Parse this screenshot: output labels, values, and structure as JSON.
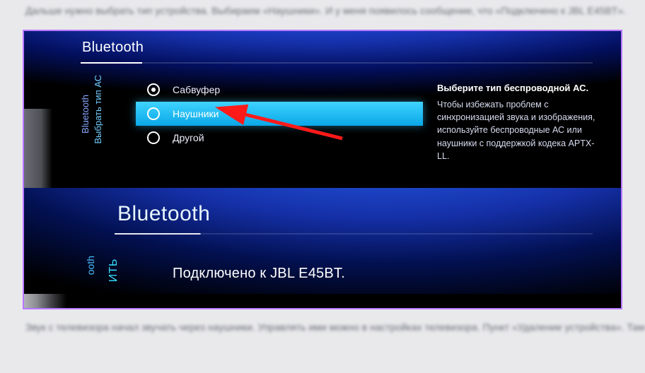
{
  "article": {
    "before": "Дальше нужно выбрать тип устройства. Выбираем «Наушники». И у меня появилось сообщение, что «Подключено к JBL E45BT».",
    "after": "Звук с телевизора начал звучать через наушники. Управлять ими можно в настройках телевизора. Пункт «Удаление устройства». Там можно отключить или удалить беспроводную гарнитуру."
  },
  "screen1": {
    "header": "Bluetooth",
    "sidebar": {
      "label1": "Bluetooth",
      "label2": "Выбрать тип АС"
    },
    "options": [
      {
        "label": "Сабвуфер",
        "selected": true
      },
      {
        "label": "Наушники",
        "selected": false
      },
      {
        "label": "Другой",
        "selected": false
      }
    ],
    "help": {
      "title": "Выберите тип беспроводной АС.",
      "body": "Чтобы избежать проблем с синхронизацией звука и изображения, используйте беспроводные АС или наушники с поддержкой кодека APTX-LL."
    }
  },
  "screen2": {
    "header": "Bluetooth",
    "sidebar": {
      "partial1": "ooth",
      "partial2": "ИТЬ"
    },
    "status": "Подключено к JBL E45BT."
  }
}
